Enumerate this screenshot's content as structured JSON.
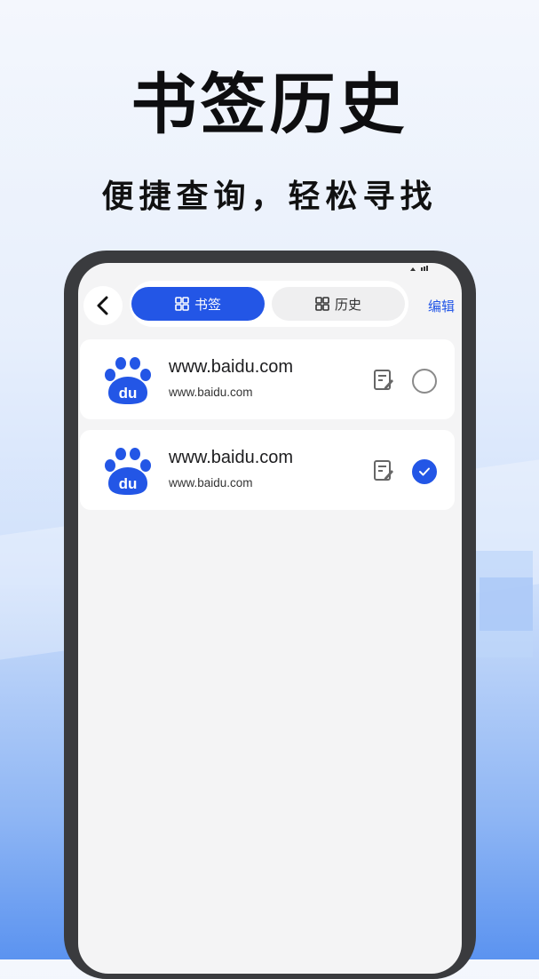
{
  "promo": {
    "headline": "书签历史",
    "subline": "便捷查询，轻松寻找"
  },
  "header": {
    "back_icon": "chevron-left-icon",
    "tabs": [
      {
        "label": "书签",
        "icon": "grid-icon",
        "active": true
      },
      {
        "label": "历史",
        "icon": "grid-icon",
        "active": false
      }
    ],
    "edit_label": "编辑"
  },
  "bookmarks": [
    {
      "title": "www.baidu.com",
      "url": "www.baidu.com",
      "logo": "baidu-paw-logo",
      "selected": false
    },
    {
      "title": "www.baidu.com",
      "url": "www.baidu.com",
      "logo": "baidu-paw-logo",
      "selected": true
    }
  ],
  "colors": {
    "accent": "#2356e6",
    "frame": "#3a3b3e",
    "screen_bg": "#f4f4f5"
  }
}
